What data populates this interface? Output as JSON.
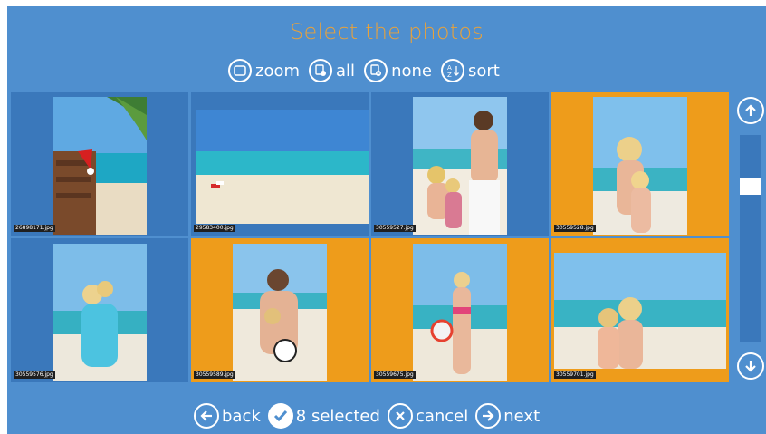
{
  "header": {
    "title": "Select the photos"
  },
  "toolbar": {
    "zoom_label": "zoom",
    "all_label": "all",
    "none_label": "none",
    "sort_label": "sort"
  },
  "photos": [
    {
      "filename": "26898171.jpg",
      "selected": false
    },
    {
      "filename": "29583400.jpg",
      "selected": false
    },
    {
      "filename": "30559527.jpg",
      "selected": false
    },
    {
      "filename": "30559528.jpg",
      "selected": true
    },
    {
      "filename": "30559576.jpg",
      "selected": false
    },
    {
      "filename": "30559589.jpg",
      "selected": true
    },
    {
      "filename": "30559675.jpg",
      "selected": true
    },
    {
      "filename": "30559701.jpg",
      "selected": true
    }
  ],
  "footer": {
    "back_label": "back",
    "selected_label": "8 selected",
    "cancel_label": "cancel",
    "next_label": "next"
  },
  "colors": {
    "background": "#4f8fcf",
    "tile": "#3a78bb",
    "selected": "#ee9c1b",
    "title": "#e9a23b"
  }
}
